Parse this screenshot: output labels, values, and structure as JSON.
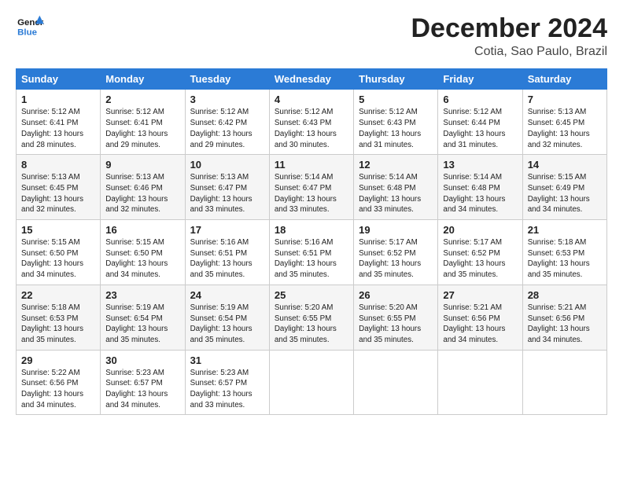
{
  "header": {
    "logo_line1": "General",
    "logo_line2": "Blue",
    "title": "December 2024",
    "subtitle": "Cotia, Sao Paulo, Brazil"
  },
  "weekdays": [
    "Sunday",
    "Monday",
    "Tuesday",
    "Wednesday",
    "Thursday",
    "Friday",
    "Saturday"
  ],
  "weeks": [
    [
      {
        "day": "1",
        "sr": "5:12 AM",
        "ss": "6:41 PM",
        "dl": "13 hours and 28 minutes."
      },
      {
        "day": "2",
        "sr": "5:12 AM",
        "ss": "6:41 PM",
        "dl": "13 hours and 29 minutes."
      },
      {
        "day": "3",
        "sr": "5:12 AM",
        "ss": "6:42 PM",
        "dl": "13 hours and 29 minutes."
      },
      {
        "day": "4",
        "sr": "5:12 AM",
        "ss": "6:43 PM",
        "dl": "13 hours and 30 minutes."
      },
      {
        "day": "5",
        "sr": "5:12 AM",
        "ss": "6:43 PM",
        "dl": "13 hours and 31 minutes."
      },
      {
        "day": "6",
        "sr": "5:12 AM",
        "ss": "6:44 PM",
        "dl": "13 hours and 31 minutes."
      },
      {
        "day": "7",
        "sr": "5:13 AM",
        "ss": "6:45 PM",
        "dl": "13 hours and 32 minutes."
      }
    ],
    [
      {
        "day": "8",
        "sr": "5:13 AM",
        "ss": "6:45 PM",
        "dl": "13 hours and 32 minutes."
      },
      {
        "day": "9",
        "sr": "5:13 AM",
        "ss": "6:46 PM",
        "dl": "13 hours and 32 minutes."
      },
      {
        "day": "10",
        "sr": "5:13 AM",
        "ss": "6:47 PM",
        "dl": "13 hours and 33 minutes."
      },
      {
        "day": "11",
        "sr": "5:14 AM",
        "ss": "6:47 PM",
        "dl": "13 hours and 33 minutes."
      },
      {
        "day": "12",
        "sr": "5:14 AM",
        "ss": "6:48 PM",
        "dl": "13 hours and 33 minutes."
      },
      {
        "day": "13",
        "sr": "5:14 AM",
        "ss": "6:48 PM",
        "dl": "13 hours and 34 minutes."
      },
      {
        "day": "14",
        "sr": "5:15 AM",
        "ss": "6:49 PM",
        "dl": "13 hours and 34 minutes."
      }
    ],
    [
      {
        "day": "15",
        "sr": "5:15 AM",
        "ss": "6:50 PM",
        "dl": "13 hours and 34 minutes."
      },
      {
        "day": "16",
        "sr": "5:15 AM",
        "ss": "6:50 PM",
        "dl": "13 hours and 34 minutes."
      },
      {
        "day": "17",
        "sr": "5:16 AM",
        "ss": "6:51 PM",
        "dl": "13 hours and 35 minutes."
      },
      {
        "day": "18",
        "sr": "5:16 AM",
        "ss": "6:51 PM",
        "dl": "13 hours and 35 minutes."
      },
      {
        "day": "19",
        "sr": "5:17 AM",
        "ss": "6:52 PM",
        "dl": "13 hours and 35 minutes."
      },
      {
        "day": "20",
        "sr": "5:17 AM",
        "ss": "6:52 PM",
        "dl": "13 hours and 35 minutes."
      },
      {
        "day": "21",
        "sr": "5:18 AM",
        "ss": "6:53 PM",
        "dl": "13 hours and 35 minutes."
      }
    ],
    [
      {
        "day": "22",
        "sr": "5:18 AM",
        "ss": "6:53 PM",
        "dl": "13 hours and 35 minutes."
      },
      {
        "day": "23",
        "sr": "5:19 AM",
        "ss": "6:54 PM",
        "dl": "13 hours and 35 minutes."
      },
      {
        "day": "24",
        "sr": "5:19 AM",
        "ss": "6:54 PM",
        "dl": "13 hours and 35 minutes."
      },
      {
        "day": "25",
        "sr": "5:20 AM",
        "ss": "6:55 PM",
        "dl": "13 hours and 35 minutes."
      },
      {
        "day": "26",
        "sr": "5:20 AM",
        "ss": "6:55 PM",
        "dl": "13 hours and 35 minutes."
      },
      {
        "day": "27",
        "sr": "5:21 AM",
        "ss": "6:56 PM",
        "dl": "13 hours and 34 minutes."
      },
      {
        "day": "28",
        "sr": "5:21 AM",
        "ss": "6:56 PM",
        "dl": "13 hours and 34 minutes."
      }
    ],
    [
      {
        "day": "29",
        "sr": "5:22 AM",
        "ss": "6:56 PM",
        "dl": "13 hours and 34 minutes."
      },
      {
        "day": "30",
        "sr": "5:23 AM",
        "ss": "6:57 PM",
        "dl": "13 hours and 34 minutes."
      },
      {
        "day": "31",
        "sr": "5:23 AM",
        "ss": "6:57 PM",
        "dl": "13 hours and 33 minutes."
      },
      null,
      null,
      null,
      null
    ]
  ]
}
